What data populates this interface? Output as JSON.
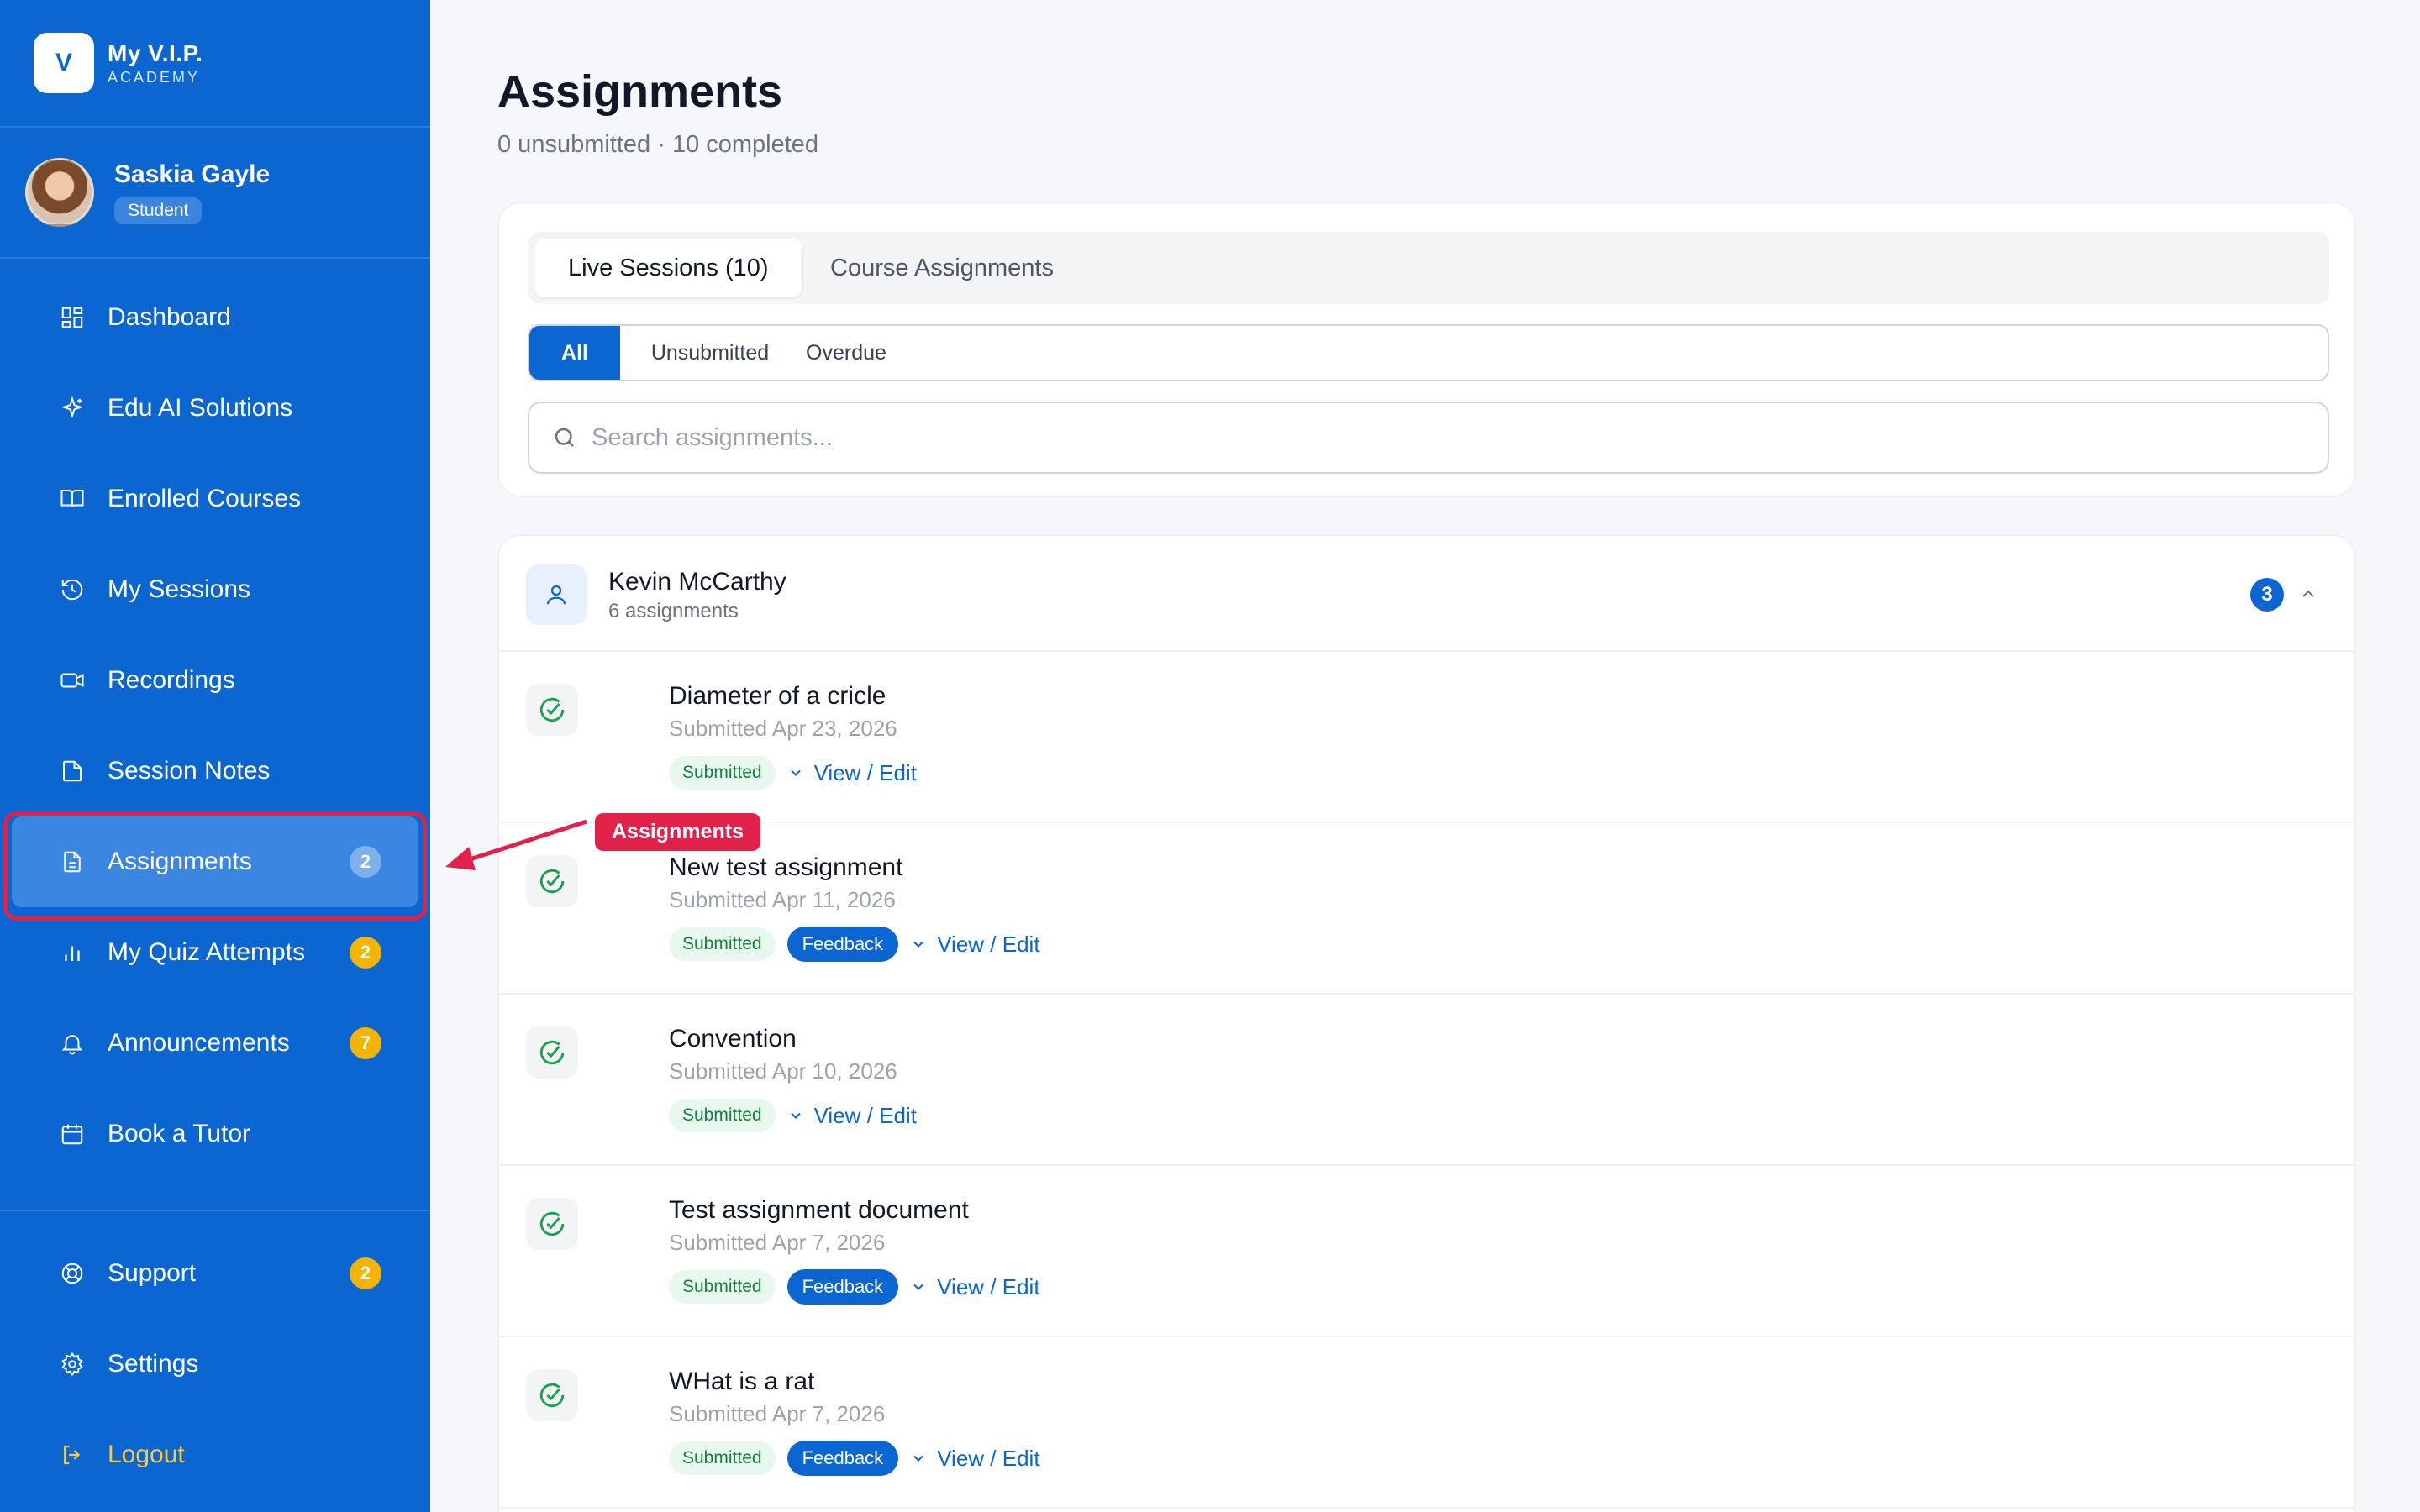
{
  "brand": {
    "initial": "V",
    "name": "My V.I.P.",
    "sub": "ACADEMY"
  },
  "profile": {
    "name": "Saskia Gayle",
    "role": "Student"
  },
  "nav": {
    "items": [
      {
        "label": "Dashboard",
        "icon": "dashboard-icon"
      },
      {
        "label": "Edu AI Solutions",
        "icon": "sparkle-icon"
      },
      {
        "label": "Enrolled Courses",
        "icon": "book-icon"
      },
      {
        "label": "My Sessions",
        "icon": "history-icon"
      },
      {
        "label": "Recordings",
        "icon": "video-icon"
      },
      {
        "label": "Session Notes",
        "icon": "note-icon"
      },
      {
        "label": "Assignments",
        "icon": "document-icon",
        "badge": "2"
      },
      {
        "label": "My Quiz Attempts",
        "icon": "bar-chart-icon",
        "badge": "2"
      },
      {
        "label": "Announcements",
        "icon": "bell-icon",
        "badge": "7"
      },
      {
        "label": "Book a Tutor",
        "icon": "calendar-icon"
      }
    ],
    "bottom": [
      {
        "label": "Support",
        "icon": "lifebuoy-icon",
        "badge": "2"
      },
      {
        "label": "Settings",
        "icon": "gear-icon"
      },
      {
        "label": "Logout",
        "icon": "logout-icon"
      }
    ]
  },
  "page": {
    "title": "Assignments",
    "subtitle": "0 unsubmitted · 10 completed"
  },
  "tabs": [
    "Live Sessions (10)",
    "Course Assignments"
  ],
  "filters": [
    "All",
    "Unsubmitted",
    "Overdue"
  ],
  "search": {
    "placeholder": "Search assignments..."
  },
  "group": {
    "name": "Kevin McCarthy",
    "count": "6 assignments",
    "badge": "3"
  },
  "assignments": [
    {
      "title": "Diameter of a cricle",
      "date": "Submitted Apr 23, 2026",
      "status": "Submitted",
      "feedback": "",
      "action": "View / Edit"
    },
    {
      "title": "New test assignment",
      "date": "Submitted Apr 11, 2026",
      "status": "Submitted",
      "feedback": "Feedback",
      "action": "View / Edit"
    },
    {
      "title": "Convention",
      "date": "Submitted Apr 10, 2026",
      "status": "Submitted",
      "feedback": "",
      "action": "View / Edit"
    },
    {
      "title": "Test assignment document",
      "date": "Submitted Apr 7, 2026",
      "status": "Submitted",
      "feedback": "Feedback",
      "action": "View / Edit"
    },
    {
      "title": "WHat is a rat",
      "date": "Submitted Apr 7, 2026",
      "status": "Submitted",
      "feedback": "Feedback",
      "action": "View / Edit"
    }
  ],
  "annotation": {
    "label": "Assignments"
  },
  "colors": {
    "primary": "#0b66d2",
    "highlight": "#e0224b",
    "badge": "#f5b400",
    "success": "#15803d"
  }
}
